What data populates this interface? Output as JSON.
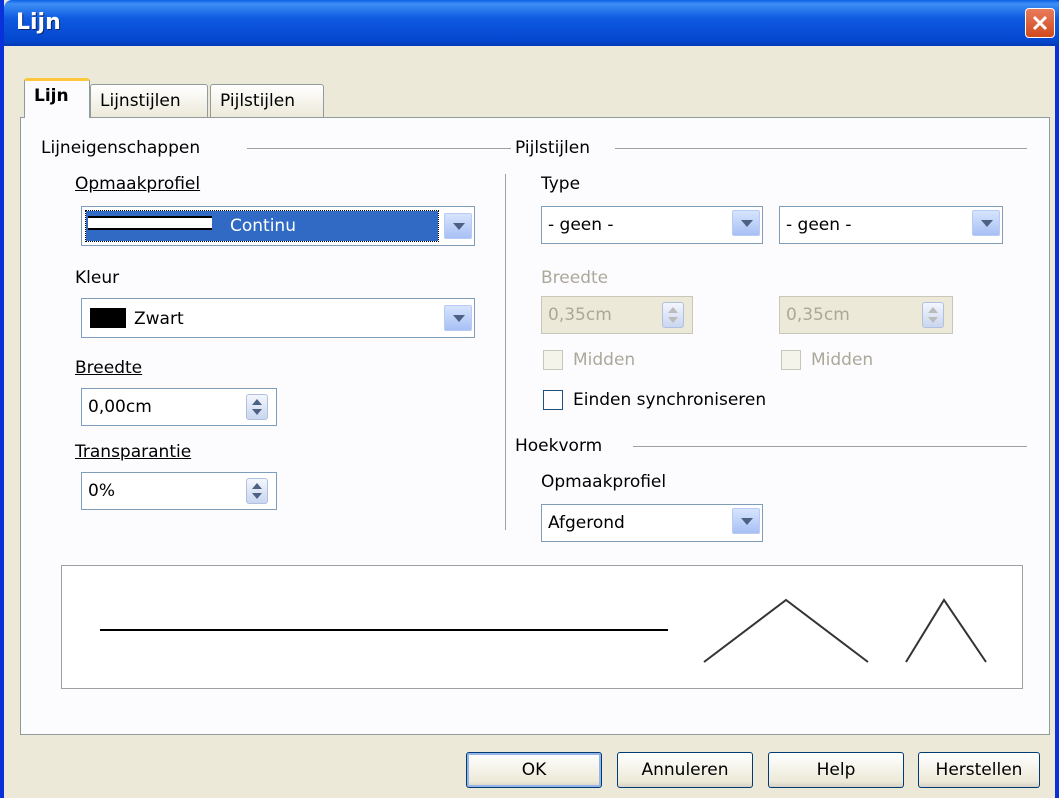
{
  "window": {
    "title": "Lijn"
  },
  "tabs": [
    {
      "label": "Lijn",
      "active": true
    },
    {
      "label": "Lijnstijlen",
      "active": false
    },
    {
      "label": "Pijlstijlen",
      "active": false
    }
  ],
  "line_properties": {
    "section_title": "Lijneigenschappen",
    "style_label": "Opmaakprofiel",
    "style_value": "Continu",
    "color_label": "Kleur",
    "color_value": "Zwart",
    "color_swatch": "#000000",
    "width_label": "Breedte",
    "width_value": "0,00cm",
    "transparency_label": "Transparantie",
    "transparency_value": "0%"
  },
  "arrow_styles": {
    "section_title": "Pijlstijlen",
    "type_label": "Type",
    "start_type": "- geen -",
    "end_type": "- geen -",
    "width_label": "Breedte",
    "start_width": "0,35cm",
    "end_width": "0,35cm",
    "center_label_start": "Midden",
    "center_label_end": "Midden",
    "sync_label": "Einden synchroniseren"
  },
  "corner_style": {
    "section_title": "Hoekvorm",
    "style_label": "Opmaakprofiel",
    "style_value": "Afgerond"
  },
  "buttons": {
    "ok": "OK",
    "cancel": "Annuleren",
    "help": "Help",
    "reset": "Herstellen"
  },
  "colors": {
    "selection": "#316ac5",
    "titlebar": "#0a5fe8",
    "tab_highlight": "#ffc83c"
  }
}
